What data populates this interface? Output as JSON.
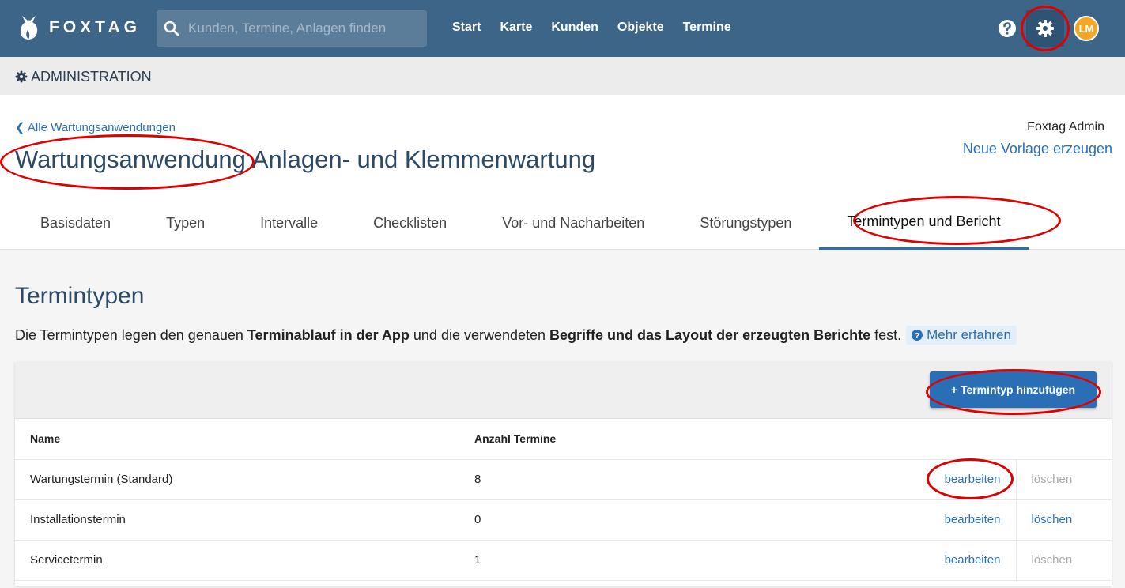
{
  "app": {
    "brand": "FOXTAG",
    "search_placeholder": "Kunden, Termine, Anlagen finden",
    "nav": [
      "Start",
      "Karte",
      "Kunden",
      "Objekte",
      "Termine"
    ],
    "avatar_initials": "LM"
  },
  "admin_bar": {
    "label": "ADMINISTRATION"
  },
  "header": {
    "back_link": "Alle Wartungsanwendungen",
    "title": "Wartungsanwendung",
    "subtitle": "Anlagen- und Klemmenwartung",
    "user_name": "Foxtag Admin",
    "new_template_link": "Neue Vorlage erzeugen"
  },
  "tabs": [
    {
      "label": "Basisdaten"
    },
    {
      "label": "Typen"
    },
    {
      "label": "Intervalle"
    },
    {
      "label": "Checklisten"
    },
    {
      "label": "Vor- und Nacharbeiten"
    },
    {
      "label": "Störungstypen"
    },
    {
      "label": "Termintypen und Bericht",
      "active": true
    }
  ],
  "section": {
    "title": "Termintypen",
    "desc_1": "Die Termintypen legen den genauen ",
    "desc_bold_1": "Terminablauf in der App",
    "desc_2": " und die verwendeten ",
    "desc_bold_2": "Begriffe und das Layout der erzeugten Berichte",
    "desc_3": " fest.",
    "more_link": "Mehr erfahren"
  },
  "table": {
    "add_button": "Termintyp hinzufügen",
    "headers": {
      "name": "Name",
      "count": "Anzahl Termine"
    },
    "rows": [
      {
        "name": "Wartungstermin (Standard)",
        "count": "8",
        "edit": "bearbeiten",
        "delete": "löschen",
        "delete_enabled": false
      },
      {
        "name": "Installationstermin",
        "count": "0",
        "edit": "bearbeiten",
        "delete": "löschen",
        "delete_enabled": true
      },
      {
        "name": "Servicetermin",
        "count": "1",
        "edit": "bearbeiten",
        "delete": "löschen",
        "delete_enabled": false
      }
    ]
  },
  "colors": {
    "topbar": "#3d6587",
    "accent": "#2a6fb5",
    "annotation": "#e00000",
    "avatar": "#f5a623"
  }
}
